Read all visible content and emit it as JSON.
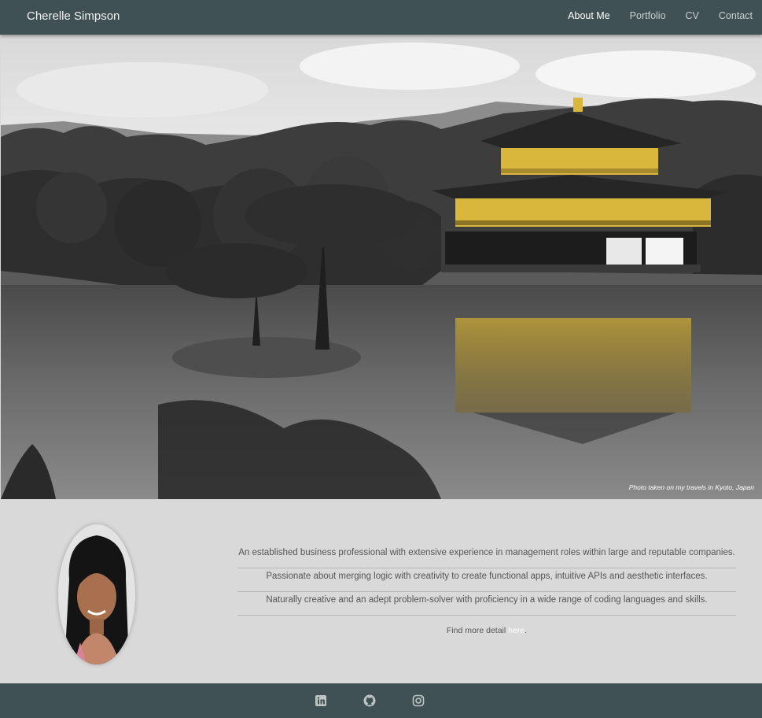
{
  "nav": {
    "brand": "Cherelle Simpson",
    "links": [
      {
        "label": "About Me",
        "active": true
      },
      {
        "label": "Portfolio",
        "active": false
      },
      {
        "label": "CV",
        "active": false
      },
      {
        "label": "Contact",
        "active": false
      }
    ]
  },
  "hero": {
    "caption": "Photo taken on my travels in Kyoto, Japan"
  },
  "about": {
    "bio": [
      "An established business professional with extensive experience in management roles within large and reputable companies.",
      "Passionate about merging logic with creativity to create functional apps, intuitive APIs and aesthetic interfaces.",
      "Naturally creative and an adept problem-solver with proficiency in a wide range of coding languages and skills."
    ],
    "more_prefix": "Find more detail ",
    "more_link": "here",
    "more_suffix": "."
  },
  "footer": {
    "icons": [
      "linkedin-icon",
      "github-icon",
      "instagram-icon"
    ]
  },
  "colors": {
    "nav_bg": "#3f5152",
    "page_bg": "#d9d9d9",
    "gold": "#d8b73c"
  }
}
